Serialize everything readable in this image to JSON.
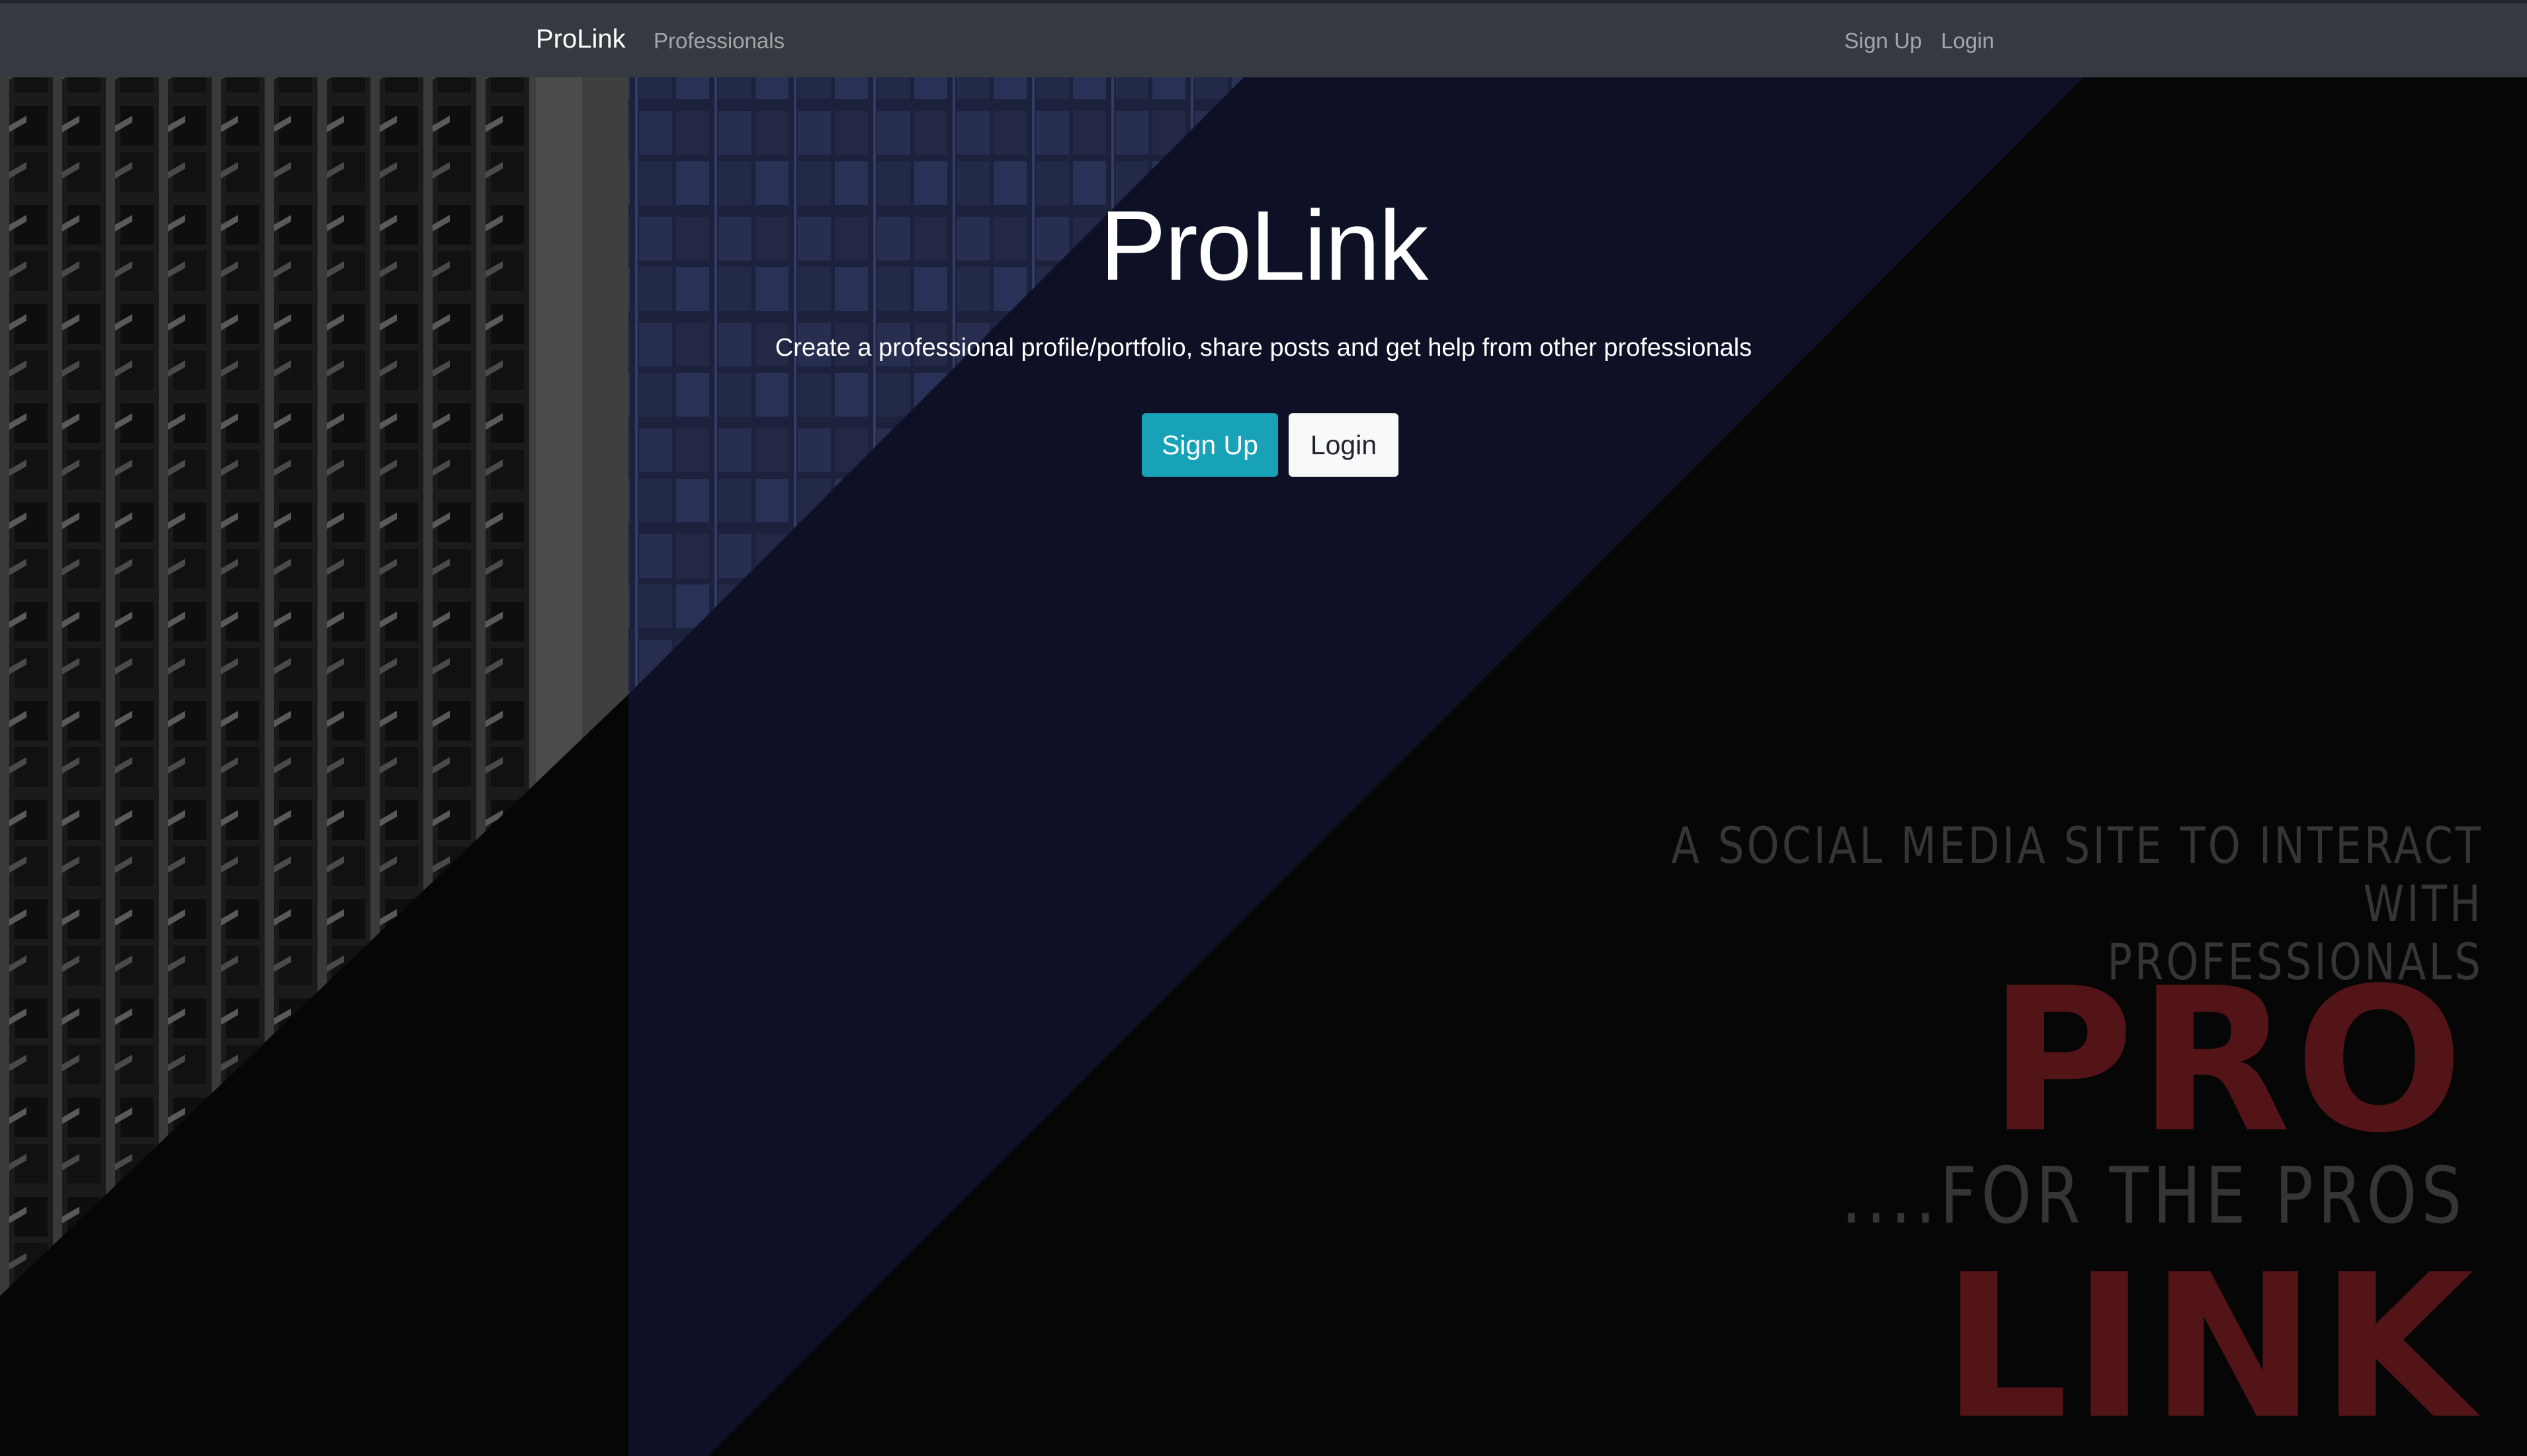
{
  "navbar": {
    "brand": "ProLink",
    "links": {
      "professionals": "Professionals",
      "signup": "Sign Up",
      "login": "Login"
    },
    "background_color": "#343a40"
  },
  "hero": {
    "title": "ProLink",
    "lead": "Create a professional profile/portfolio, share posts and get help from other professionals",
    "buttons": {
      "signup": "Sign Up",
      "login": "Login"
    },
    "signup_color": "#17a2b8",
    "login_color": "#f8f9fa"
  },
  "poster": {
    "tagline_line1": "A SOCIAL MEDIA SITE TO INTERACT WITH",
    "tagline_line2": "PROFESSIONALS",
    "pro": "PRO",
    "for_the_pros": "....FOR THE PROS",
    "link": "LINK",
    "accent_color": "#521417"
  }
}
